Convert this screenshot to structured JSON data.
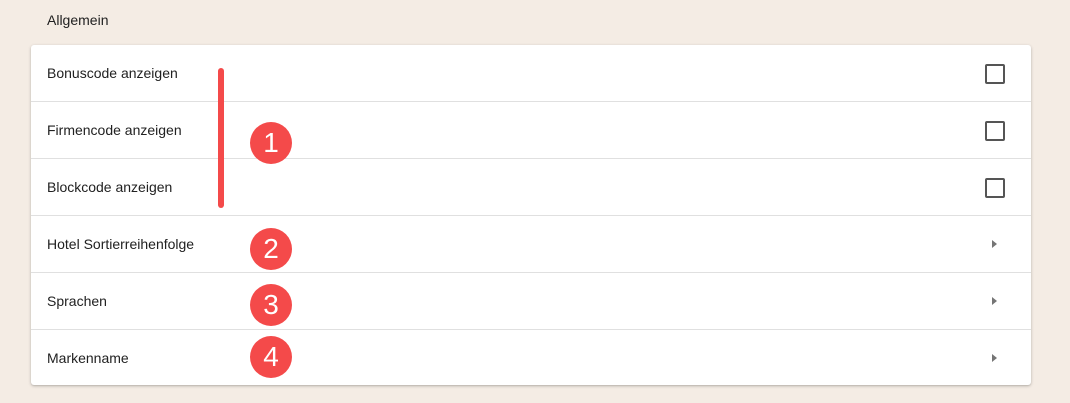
{
  "section": {
    "title": "Allgemein"
  },
  "settings": {
    "rows": [
      {
        "label": "Bonuscode anzeigen",
        "control": "checkbox",
        "checked": false
      },
      {
        "label": "Firmencode anzeigen",
        "control": "checkbox",
        "checked": false
      },
      {
        "label": "Blockcode anzeigen",
        "control": "checkbox",
        "checked": false
      },
      {
        "label": "Hotel Sortierreihenfolge",
        "control": "chevron-right-icon"
      },
      {
        "label": "Sprachen",
        "control": "chevron-right-icon"
      },
      {
        "label": "Markenname",
        "control": "chevron-right-icon"
      }
    ]
  },
  "annotations": {
    "color": "#f44a4a",
    "badges": [
      "1",
      "2",
      "3",
      "4"
    ]
  }
}
